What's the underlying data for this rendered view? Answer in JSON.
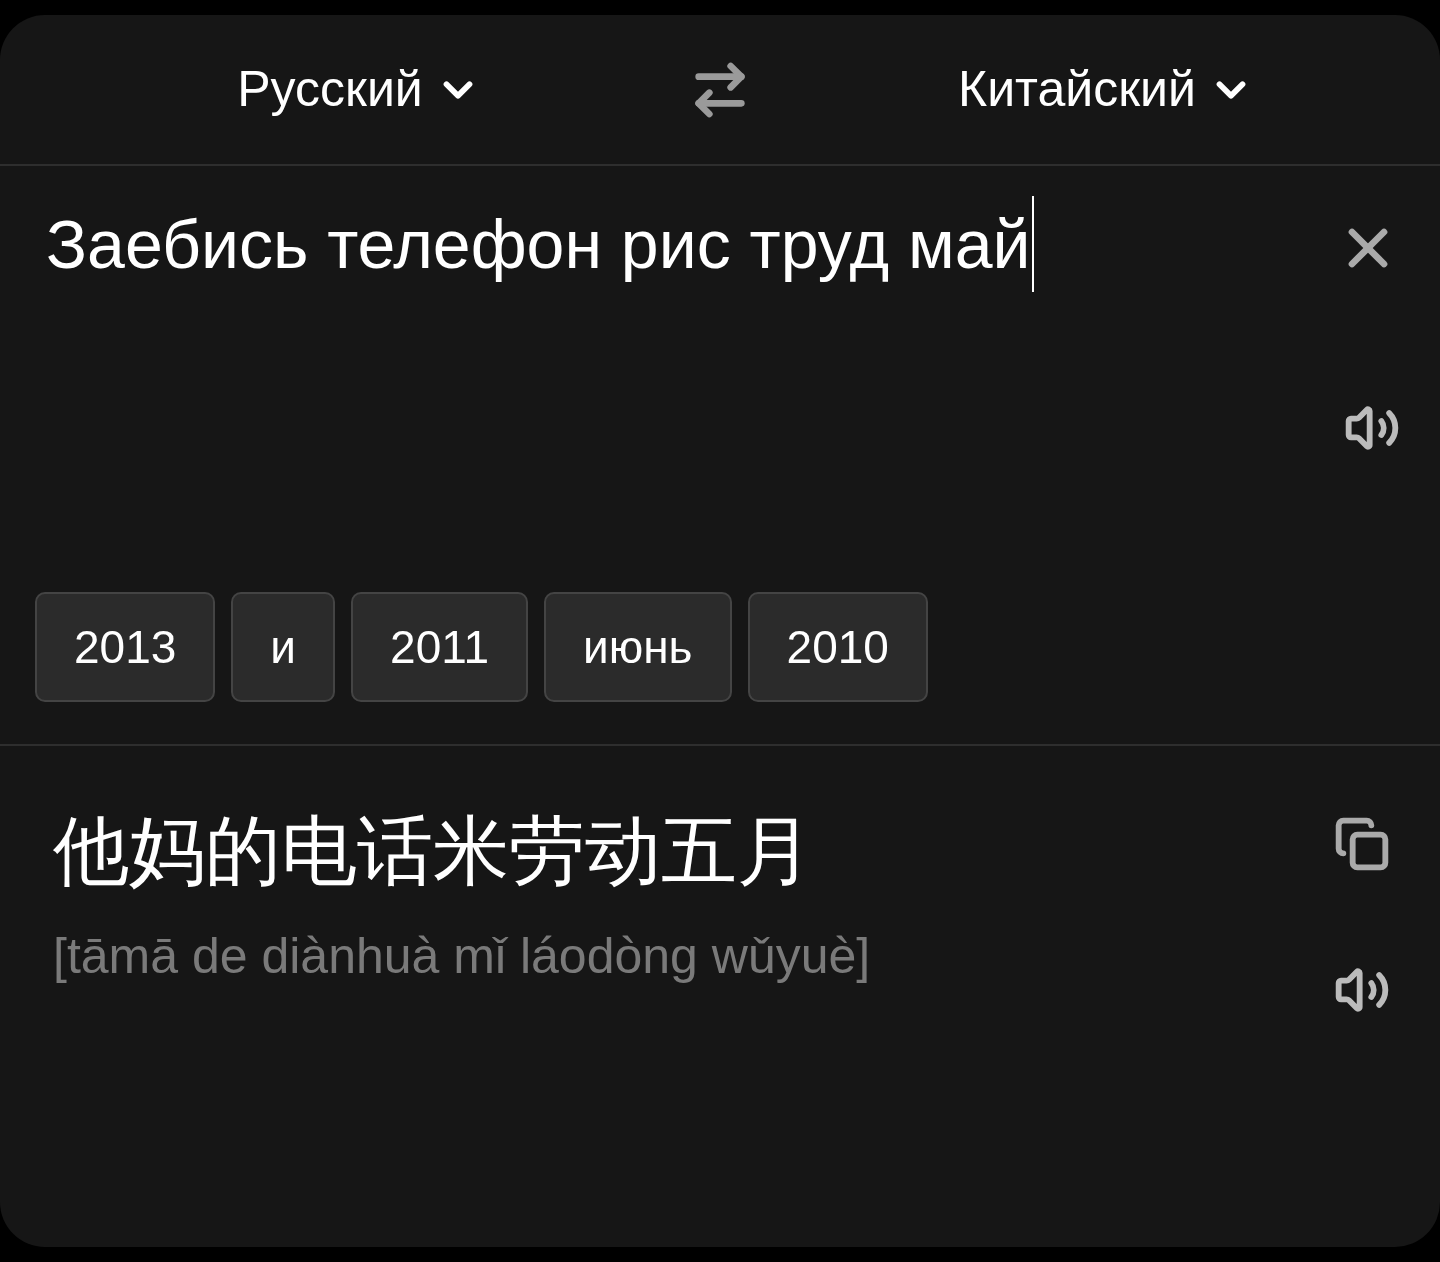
{
  "languages": {
    "source": "Русский",
    "target": "Китайский"
  },
  "input": {
    "value": "Заебись телефон рис труд май",
    "focused": true
  },
  "suggestions": [
    "2013",
    "и",
    "2011",
    "июнь",
    "2010"
  ],
  "output": {
    "text": "他妈的电话米劳动五月",
    "transliteration": "[tāmā de diànhuà mǐ láodòng wǔyuè]"
  }
}
